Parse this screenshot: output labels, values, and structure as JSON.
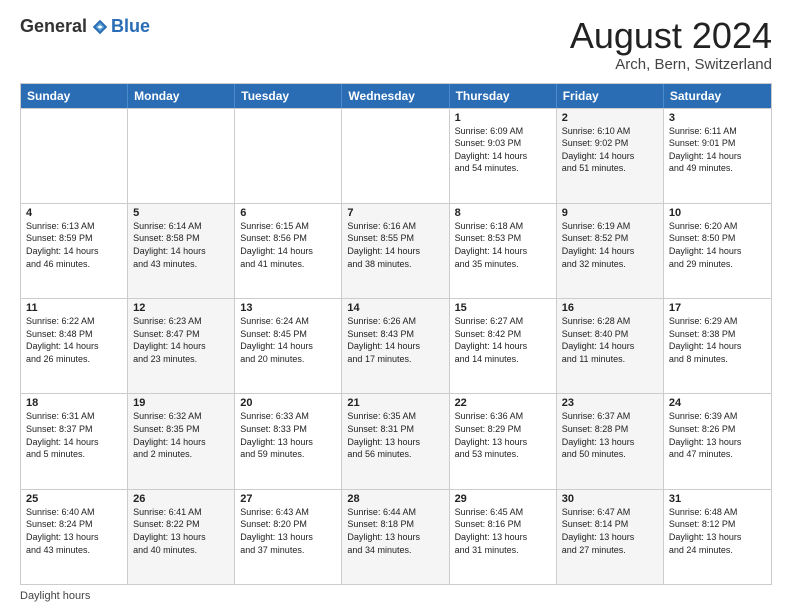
{
  "logo": {
    "general": "General",
    "blue": "Blue"
  },
  "title": "August 2024",
  "subtitle": "Arch, Bern, Switzerland",
  "days_of_week": [
    "Sunday",
    "Monday",
    "Tuesday",
    "Wednesday",
    "Thursday",
    "Friday",
    "Saturday"
  ],
  "footer": "Daylight hours",
  "weeks": [
    [
      {
        "num": "",
        "info": "",
        "empty": true
      },
      {
        "num": "",
        "info": "",
        "empty": true
      },
      {
        "num": "",
        "info": "",
        "empty": true
      },
      {
        "num": "",
        "info": "",
        "empty": true
      },
      {
        "num": "1",
        "info": "Sunrise: 6:09 AM\nSunset: 9:03 PM\nDaylight: 14 hours\nand 54 minutes.",
        "empty": false,
        "shaded": false
      },
      {
        "num": "2",
        "info": "Sunrise: 6:10 AM\nSunset: 9:02 PM\nDaylight: 14 hours\nand 51 minutes.",
        "empty": false,
        "shaded": true
      },
      {
        "num": "3",
        "info": "Sunrise: 6:11 AM\nSunset: 9:01 PM\nDaylight: 14 hours\nand 49 minutes.",
        "empty": false,
        "shaded": false
      }
    ],
    [
      {
        "num": "4",
        "info": "Sunrise: 6:13 AM\nSunset: 8:59 PM\nDaylight: 14 hours\nand 46 minutes.",
        "empty": false,
        "shaded": false
      },
      {
        "num": "5",
        "info": "Sunrise: 6:14 AM\nSunset: 8:58 PM\nDaylight: 14 hours\nand 43 minutes.",
        "empty": false,
        "shaded": true
      },
      {
        "num": "6",
        "info": "Sunrise: 6:15 AM\nSunset: 8:56 PM\nDaylight: 14 hours\nand 41 minutes.",
        "empty": false,
        "shaded": false
      },
      {
        "num": "7",
        "info": "Sunrise: 6:16 AM\nSunset: 8:55 PM\nDaylight: 14 hours\nand 38 minutes.",
        "empty": false,
        "shaded": true
      },
      {
        "num": "8",
        "info": "Sunrise: 6:18 AM\nSunset: 8:53 PM\nDaylight: 14 hours\nand 35 minutes.",
        "empty": false,
        "shaded": false
      },
      {
        "num": "9",
        "info": "Sunrise: 6:19 AM\nSunset: 8:52 PM\nDaylight: 14 hours\nand 32 minutes.",
        "empty": false,
        "shaded": true
      },
      {
        "num": "10",
        "info": "Sunrise: 6:20 AM\nSunset: 8:50 PM\nDaylight: 14 hours\nand 29 minutes.",
        "empty": false,
        "shaded": false
      }
    ],
    [
      {
        "num": "11",
        "info": "Sunrise: 6:22 AM\nSunset: 8:48 PM\nDaylight: 14 hours\nand 26 minutes.",
        "empty": false,
        "shaded": false
      },
      {
        "num": "12",
        "info": "Sunrise: 6:23 AM\nSunset: 8:47 PM\nDaylight: 14 hours\nand 23 minutes.",
        "empty": false,
        "shaded": true
      },
      {
        "num": "13",
        "info": "Sunrise: 6:24 AM\nSunset: 8:45 PM\nDaylight: 14 hours\nand 20 minutes.",
        "empty": false,
        "shaded": false
      },
      {
        "num": "14",
        "info": "Sunrise: 6:26 AM\nSunset: 8:43 PM\nDaylight: 14 hours\nand 17 minutes.",
        "empty": false,
        "shaded": true
      },
      {
        "num": "15",
        "info": "Sunrise: 6:27 AM\nSunset: 8:42 PM\nDaylight: 14 hours\nand 14 minutes.",
        "empty": false,
        "shaded": false
      },
      {
        "num": "16",
        "info": "Sunrise: 6:28 AM\nSunset: 8:40 PM\nDaylight: 14 hours\nand 11 minutes.",
        "empty": false,
        "shaded": true
      },
      {
        "num": "17",
        "info": "Sunrise: 6:29 AM\nSunset: 8:38 PM\nDaylight: 14 hours\nand 8 minutes.",
        "empty": false,
        "shaded": false
      }
    ],
    [
      {
        "num": "18",
        "info": "Sunrise: 6:31 AM\nSunset: 8:37 PM\nDaylight: 14 hours\nand 5 minutes.",
        "empty": false,
        "shaded": false
      },
      {
        "num": "19",
        "info": "Sunrise: 6:32 AM\nSunset: 8:35 PM\nDaylight: 14 hours\nand 2 minutes.",
        "empty": false,
        "shaded": true
      },
      {
        "num": "20",
        "info": "Sunrise: 6:33 AM\nSunset: 8:33 PM\nDaylight: 13 hours\nand 59 minutes.",
        "empty": false,
        "shaded": false
      },
      {
        "num": "21",
        "info": "Sunrise: 6:35 AM\nSunset: 8:31 PM\nDaylight: 13 hours\nand 56 minutes.",
        "empty": false,
        "shaded": true
      },
      {
        "num": "22",
        "info": "Sunrise: 6:36 AM\nSunset: 8:29 PM\nDaylight: 13 hours\nand 53 minutes.",
        "empty": false,
        "shaded": false
      },
      {
        "num": "23",
        "info": "Sunrise: 6:37 AM\nSunset: 8:28 PM\nDaylight: 13 hours\nand 50 minutes.",
        "empty": false,
        "shaded": true
      },
      {
        "num": "24",
        "info": "Sunrise: 6:39 AM\nSunset: 8:26 PM\nDaylight: 13 hours\nand 47 minutes.",
        "empty": false,
        "shaded": false
      }
    ],
    [
      {
        "num": "25",
        "info": "Sunrise: 6:40 AM\nSunset: 8:24 PM\nDaylight: 13 hours\nand 43 minutes.",
        "empty": false,
        "shaded": false
      },
      {
        "num": "26",
        "info": "Sunrise: 6:41 AM\nSunset: 8:22 PM\nDaylight: 13 hours\nand 40 minutes.",
        "empty": false,
        "shaded": true
      },
      {
        "num": "27",
        "info": "Sunrise: 6:43 AM\nSunset: 8:20 PM\nDaylight: 13 hours\nand 37 minutes.",
        "empty": false,
        "shaded": false
      },
      {
        "num": "28",
        "info": "Sunrise: 6:44 AM\nSunset: 8:18 PM\nDaylight: 13 hours\nand 34 minutes.",
        "empty": false,
        "shaded": true
      },
      {
        "num": "29",
        "info": "Sunrise: 6:45 AM\nSunset: 8:16 PM\nDaylight: 13 hours\nand 31 minutes.",
        "empty": false,
        "shaded": false
      },
      {
        "num": "30",
        "info": "Sunrise: 6:47 AM\nSunset: 8:14 PM\nDaylight: 13 hours\nand 27 minutes.",
        "empty": false,
        "shaded": true
      },
      {
        "num": "31",
        "info": "Sunrise: 6:48 AM\nSunset: 8:12 PM\nDaylight: 13 hours\nand 24 minutes.",
        "empty": false,
        "shaded": false
      }
    ]
  ]
}
